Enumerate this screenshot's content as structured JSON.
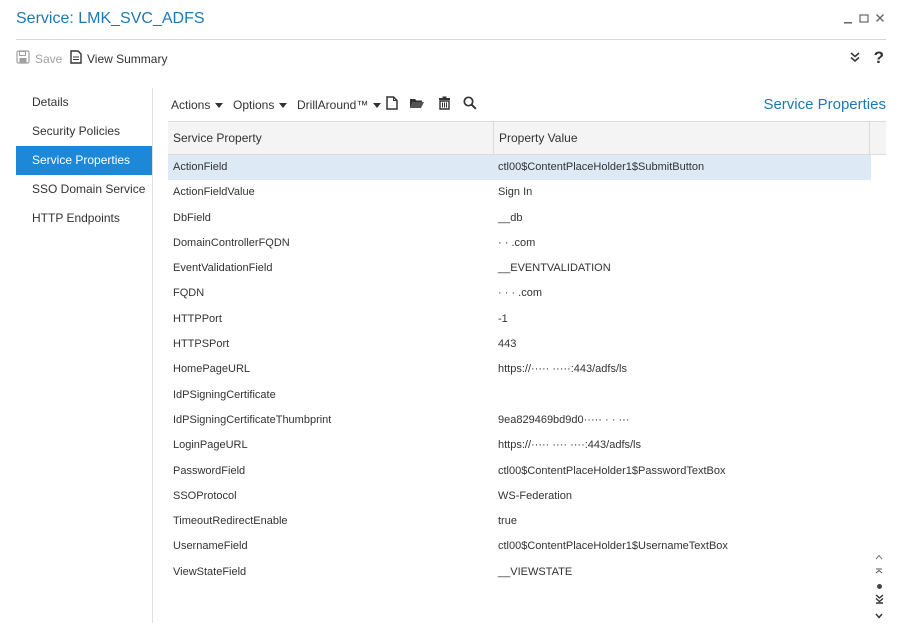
{
  "window": {
    "title": "Service: LMK_SVC_ADFS"
  },
  "toolbar": {
    "save_label": "Save",
    "summary_label": "View Summary",
    "help_label": "?"
  },
  "sidebar": {
    "items": [
      {
        "label": "Details"
      },
      {
        "label": "Security Policies"
      },
      {
        "label": "Service Properties",
        "active": true
      },
      {
        "label": "SSO Domain Service"
      },
      {
        "label": "HTTP Endpoints"
      }
    ]
  },
  "main": {
    "menus": {
      "actions": "Actions",
      "options": "Options",
      "drillaround": "DrillAround™"
    },
    "panel_title": "Service Properties",
    "columns": {
      "property": "Service Property",
      "value": "Property Value"
    },
    "rows": [
      {
        "property": "ActionField",
        "value": "ctl00$ContentPlaceHolder1$SubmitButton",
        "selected": true
      },
      {
        "property": "ActionFieldValue",
        "value": "Sign In"
      },
      {
        "property": "DbField",
        "value": "__db"
      },
      {
        "property": "DomainControllerFQDN",
        "value": "·  ·  .com"
      },
      {
        "property": "EventValidationField",
        "value": "__EVENTVALIDATION"
      },
      {
        "property": "FQDN",
        "value": "·   ·  ·  .com"
      },
      {
        "property": "HTTPPort",
        "value": "-1"
      },
      {
        "property": "HTTPSPort",
        "value": "443"
      },
      {
        "property": "HomePageURL",
        "value": "https://·····            ·····:443/adfs/ls"
      },
      {
        "property": "IdPSigningCertificate",
        "value": ""
      },
      {
        "property": "IdPSigningCertificateThumbprint",
        "value": "9ea829469bd9d0·····  ·  ·  ···"
      },
      {
        "property": "LoginPageURL",
        "value": "https://·····  ····  ····:443/adfs/ls"
      },
      {
        "property": "PasswordField",
        "value": "ctl00$ContentPlaceHolder1$PasswordTextBox"
      },
      {
        "property": "SSOProtocol",
        "value": "WS-Federation"
      },
      {
        "property": "TimeoutRedirectEnable",
        "value": "true"
      },
      {
        "property": "UsernameField",
        "value": "ctl00$ContentPlaceHolder1$UsernameTextBox"
      },
      {
        "property": "ViewStateField",
        "value": "__VIEWSTATE"
      }
    ]
  },
  "colors": {
    "accent": "#1f78b4",
    "active_nav": "#1e88d8",
    "selected_row": "#dde9f5",
    "header_bg": "#f4f4f4"
  },
  "icons": {
    "window": [
      "minimize-icon",
      "maximize-icon",
      "close-icon"
    ],
    "toolbar": [
      "save-icon",
      "summary-document-icon",
      "collapse-chevrons-icon",
      "help-icon"
    ],
    "grid_toolbar": [
      "new-document-icon",
      "open-folder-icon",
      "delete-trash-icon",
      "search-icon"
    ],
    "scroll": [
      "scroll-top-icon",
      "scroll-up-icon",
      "scroll-position-icon",
      "scroll-down-icon",
      "scroll-bottom-icon"
    ]
  }
}
